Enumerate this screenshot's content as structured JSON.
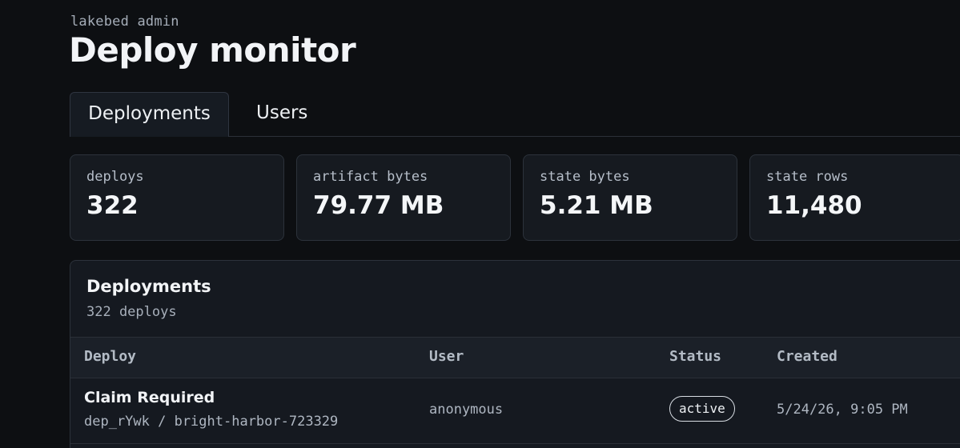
{
  "header": {
    "eyebrow": "lakebed admin",
    "title": "Deploy monitor"
  },
  "tabs": [
    {
      "label": "Deployments",
      "active": true
    },
    {
      "label": "Users",
      "active": false
    }
  ],
  "stats": [
    {
      "label": "deploys",
      "value": "322"
    },
    {
      "label": "artifact bytes",
      "value": "79.77 MB"
    },
    {
      "label": "state bytes",
      "value": "5.21 MB"
    },
    {
      "label": "state rows",
      "value": "11,480"
    }
  ],
  "deployments": {
    "title": "Deployments",
    "subtitle": "322 deploys",
    "columns": [
      "Deploy",
      "User",
      "Status",
      "Created"
    ],
    "rows": [
      {
        "name": "Claim Required",
        "id": "dep_rYwk / bright-harbor-723329",
        "user": "anonymous",
        "status": "active",
        "created": "5/24/26, 9:05 PM"
      }
    ]
  },
  "colors": {
    "background": "#0d0f12",
    "card": "#161a20",
    "border": "#2c323b"
  }
}
